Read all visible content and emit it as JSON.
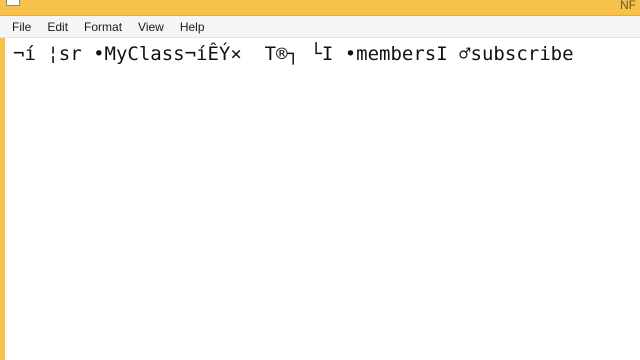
{
  "window": {
    "title": "NF"
  },
  "menu": {
    "items": [
      {
        "id": "file",
        "label": "File"
      },
      {
        "id": "edit",
        "label": "Edit"
      },
      {
        "id": "format",
        "label": "Format"
      },
      {
        "id": "view",
        "label": "View"
      },
      {
        "id": "help",
        "label": "Help"
      }
    ]
  },
  "editor": {
    "content": "¬í ¦sr •MyClass¬íÊÝ×  T®┐ └I •membersI ♂subscribe"
  },
  "colors": {
    "frame": "#f6c24a",
    "menubar": "#f5f5f5",
    "editor_bg": "#ffffff",
    "text": "#111111"
  }
}
